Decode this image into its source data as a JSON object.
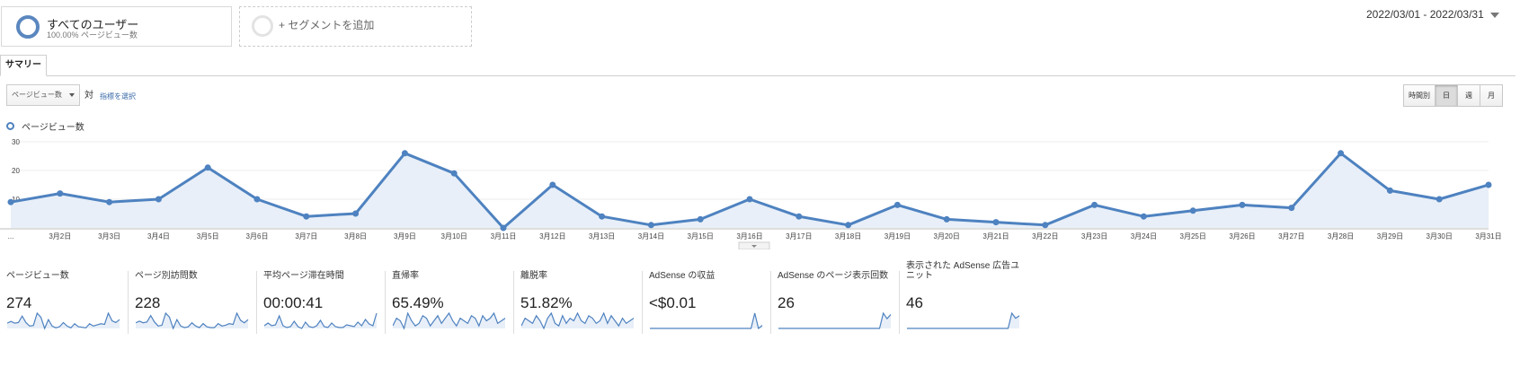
{
  "segments": [
    {
      "name": "すべてのユーザー",
      "sub": "100.00% ページビュー数"
    },
    {
      "add_label": "+ セグメントを追加"
    }
  ],
  "date_range": "2022/03/01 - 2022/03/31",
  "tabs": [
    "サマリー"
  ],
  "metric_selector": {
    "value": "ページビュー数",
    "vs": "対",
    "select_label": "指標を選択"
  },
  "period_buttons": [
    {
      "label": "時間別",
      "active": false
    },
    {
      "label": "日",
      "active": true
    },
    {
      "label": "週",
      "active": false
    },
    {
      "label": "月",
      "active": false
    }
  ],
  "colors": {
    "accent": "#4e82c0",
    "fill": "#e8eff8"
  },
  "chart_data": {
    "type": "area",
    "series": [
      {
        "name": "ページビュー数",
        "values": [
          9,
          12,
          9,
          10,
          21,
          10,
          4,
          5,
          26,
          19,
          0,
          15,
          4,
          1,
          3,
          10,
          4,
          1,
          8,
          3,
          2,
          1,
          8,
          4,
          6,
          8,
          7,
          26,
          13,
          10,
          15
        ]
      }
    ],
    "x_labels": [
      "...",
      "3月2日",
      "3月3日",
      "3月4日",
      "3月5日",
      "3月6日",
      "3月7日",
      "3月8日",
      "3月9日",
      "3月10日",
      "3月11日",
      "3月12日",
      "3月13日",
      "3月14日",
      "3月15日",
      "3月16日",
      "3月17日",
      "3月18日",
      "3月19日",
      "3月20日",
      "3月21日",
      "3月22日",
      "3月23日",
      "3月24日",
      "3月25日",
      "3月26日",
      "3月27日",
      "3月28日",
      "3月29日",
      "3月30日",
      "3月31日"
    ],
    "y_ticks": [
      10,
      20,
      30
    ],
    "ylim": [
      0,
      30
    ],
    "grid": true,
    "legend": "top-left"
  },
  "scorecards": [
    {
      "title": "ページビュー数",
      "value": "274",
      "spark": [
        9,
        12,
        9,
        10,
        21,
        10,
        4,
        5,
        26,
        19,
        0,
        15,
        4,
        1,
        3,
        10,
        4,
        1,
        8,
        3,
        2,
        1,
        8,
        4,
        6,
        8,
        7,
        26,
        13,
        10,
        15
      ]
    },
    {
      "title": "ページ別訪問数",
      "value": "228",
      "spark": [
        8,
        10,
        8,
        9,
        17,
        9,
        4,
        5,
        20,
        15,
        1,
        12,
        4,
        2,
        3,
        8,
        4,
        2,
        7,
        3,
        2,
        2,
        7,
        4,
        5,
        7,
        6,
        20,
        11,
        8,
        12
      ]
    },
    {
      "title": "平均ページ滞在時間",
      "value": "00:00:41",
      "spark": [
        3,
        6,
        3,
        4,
        14,
        3,
        1,
        2,
        8,
        2,
        0,
        7,
        2,
        1,
        3,
        9,
        2,
        1,
        6,
        2,
        1,
        1,
        4,
        3,
        2,
        7,
        3,
        10,
        5,
        3,
        17
      ]
    },
    {
      "title": "直帰率",
      "value": "65.49%",
      "spark": [
        60,
        75,
        70,
        55,
        85,
        70,
        60,
        65,
        80,
        75,
        60,
        70,
        80,
        65,
        75,
        85,
        70,
        60,
        75,
        70,
        65,
        80,
        75,
        60,
        80,
        70,
        75,
        85,
        65,
        70,
        75
      ]
    },
    {
      "title": "離脱率",
      "value": "51.82%",
      "spark": [
        50,
        65,
        60,
        55,
        70,
        60,
        45,
        65,
        75,
        55,
        50,
        70,
        55,
        65,
        60,
        75,
        60,
        55,
        70,
        65,
        55,
        60,
        75,
        55,
        70,
        60,
        50,
        65,
        55,
        60,
        65
      ]
    },
    {
      "title": "AdSense の収益",
      "value": "<$0.01",
      "spark": [
        0,
        0,
        0,
        0,
        0,
        0,
        0,
        0,
        0,
        0,
        0,
        0,
        0,
        0,
        0,
        0,
        0,
        0,
        0,
        0,
        0,
        0,
        0,
        0,
        0,
        0,
        0,
        0,
        10,
        0,
        2
      ]
    },
    {
      "title": "AdSense のページ表示回数",
      "value": "26",
      "spark": [
        0,
        0,
        0,
        0,
        0,
        0,
        0,
        0,
        0,
        0,
        0,
        0,
        0,
        0,
        0,
        0,
        0,
        0,
        0,
        0,
        0,
        0,
        0,
        0,
        0,
        0,
        0,
        0,
        11,
        7,
        10
      ]
    },
    {
      "title": "表示された AdSense 広告ユニット",
      "value": "46",
      "spark": [
        0,
        0,
        0,
        0,
        0,
        0,
        0,
        0,
        0,
        0,
        0,
        0,
        0,
        0,
        0,
        0,
        0,
        0,
        0,
        0,
        0,
        0,
        0,
        0,
        0,
        0,
        0,
        0,
        12,
        8,
        10
      ]
    }
  ]
}
